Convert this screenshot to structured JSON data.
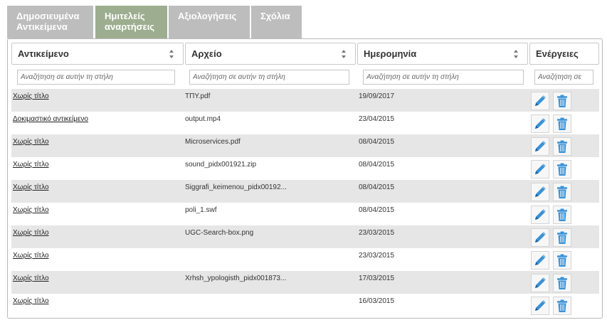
{
  "tabs": [
    {
      "line1": "Δημοσιευμένα",
      "line2": "Αντικείμενα",
      "active": false
    },
    {
      "line1": "Ημιτελείς",
      "line2": "αναρτήσεις",
      "active": true
    },
    {
      "line1": "Αξιολογήσεις",
      "line2": "",
      "active": false
    },
    {
      "line1": "Σχόλια",
      "line2": "",
      "active": false
    }
  ],
  "columns": [
    {
      "label": "Αντικείμενο",
      "sortable": true
    },
    {
      "label": "Αρχείο",
      "sortable": true
    },
    {
      "label": "Ημερομηνία",
      "sortable": true
    },
    {
      "label": "Ενέργειες",
      "sortable": false
    }
  ],
  "filters": {
    "object_placeholder": "Αναζήτηση σε αυτήν τη στήλη",
    "file_placeholder": "Αναζήτηση σε αυτήν τη στήλη",
    "date_placeholder": "Αναζήτηση σε αυτήν τη στήλη",
    "actions_placeholder": "Αναζήτηση σε"
  },
  "rows": [
    {
      "object": "Χωρίς τίτλο",
      "file": "ΤΠΥ.pdf",
      "date": "19/09/2017"
    },
    {
      "object": "Δοκιμαστικό αντικείμενο",
      "file": "output.mp4",
      "date": "23/04/2015"
    },
    {
      "object": "Χωρίς τίτλο",
      "file": "Microservices.pdf",
      "date": "08/04/2015"
    },
    {
      "object": "Χωρίς τίτλο",
      "file": "sound_pidx001921.zip",
      "date": "08/04/2015"
    },
    {
      "object": "Χωρίς τίτλο",
      "file": "Siggrafi_keimenou_pidx00192...",
      "date": "08/04/2015"
    },
    {
      "object": "Χωρίς τίτλο",
      "file": "poli_1.swf",
      "date": "08/04/2015"
    },
    {
      "object": "Χωρίς τίτλο",
      "file": "UGC-Search-box.png",
      "date": "23/03/2015"
    },
    {
      "object": "Χωρίς τίτλο",
      "file": "",
      "date": "23/03/2015"
    },
    {
      "object": "Χωρίς τίτλο",
      "file": "Xrhsh_ypologisth_pidx001873...",
      "date": "17/03/2015"
    },
    {
      "object": "Χωρίς τίτλο",
      "file": "",
      "date": "16/03/2015"
    }
  ],
  "icons": {
    "edit": "pencil-icon",
    "delete": "trash-icon",
    "sort": "sort-arrows-icon"
  },
  "colors": {
    "active_tab": "#9cae8f",
    "inactive_tab": "#bdbdbd",
    "action_icon": "#3a92d6",
    "row_stripe": "#e6e6e6"
  }
}
